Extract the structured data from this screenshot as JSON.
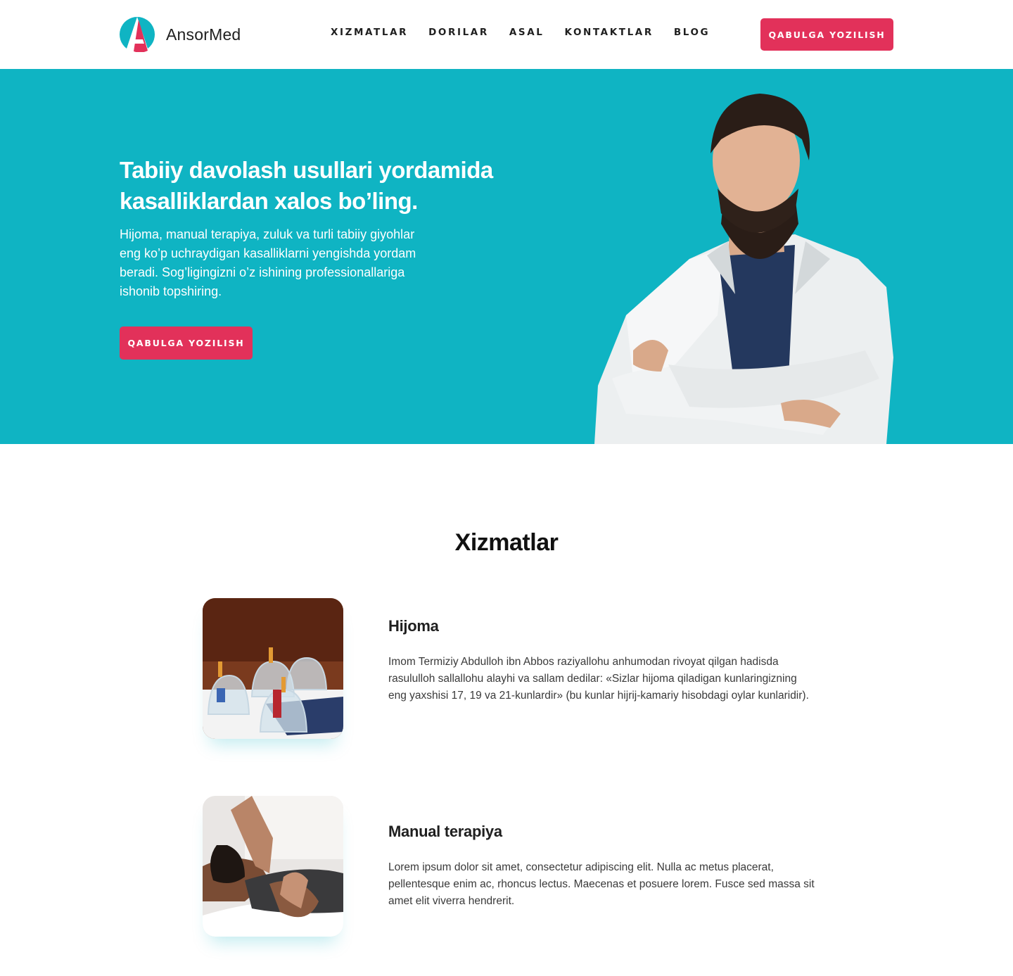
{
  "brand": {
    "name": "AnsorMed",
    "accent": "#e2315a",
    "teal": "#0fb4c3"
  },
  "nav": [
    {
      "label": "XIZMATLAR"
    },
    {
      "label": "DORILAR"
    },
    {
      "label": "ASAL"
    },
    {
      "label": "KONTAKTLAR"
    },
    {
      "label": "BLOG"
    }
  ],
  "header": {
    "cta_label": "QABULGA YOZILISH"
  },
  "hero": {
    "title": "Tabiiy davolash usullari yordamida kasalliklardan xalos bo’ling.",
    "text": "Hijoma, manual terapiya, zuluk va turli tabiiy giyohlar eng ko’p uchraydigan kasalliklarni yengishda yordam beradi. Sog’ligingizni o’z ishining professionallariga ishonib topshiring.",
    "cta_label": "QABULGA YOZILISH"
  },
  "services": {
    "title": "Xizmatlar",
    "items": [
      {
        "title": "Hijoma",
        "text": "Imom Termiziy Abdulloh ibn Abbos raziyallohu anhumodan rivoyat qilgan hadisda rasululloh sallallohu alayhi va sallam dedilar: «Sizlar hijoma qiladigan kunlaringizning eng yaxshisi 17, 19 va 21-kunlardir» (bu kunlar hijrij-kamariy hisobdagi oylar kunlaridir)."
      },
      {
        "title": "Manual terapiya",
        "text": "Lorem ipsum dolor sit amet, consectetur adipiscing elit. Nulla ac metus placerat, pellentesque enim ac, rhoncus lectus. Maecenas et posuere lorem. Fusce sed massa sit amet elit viverra hendrerit."
      }
    ]
  }
}
